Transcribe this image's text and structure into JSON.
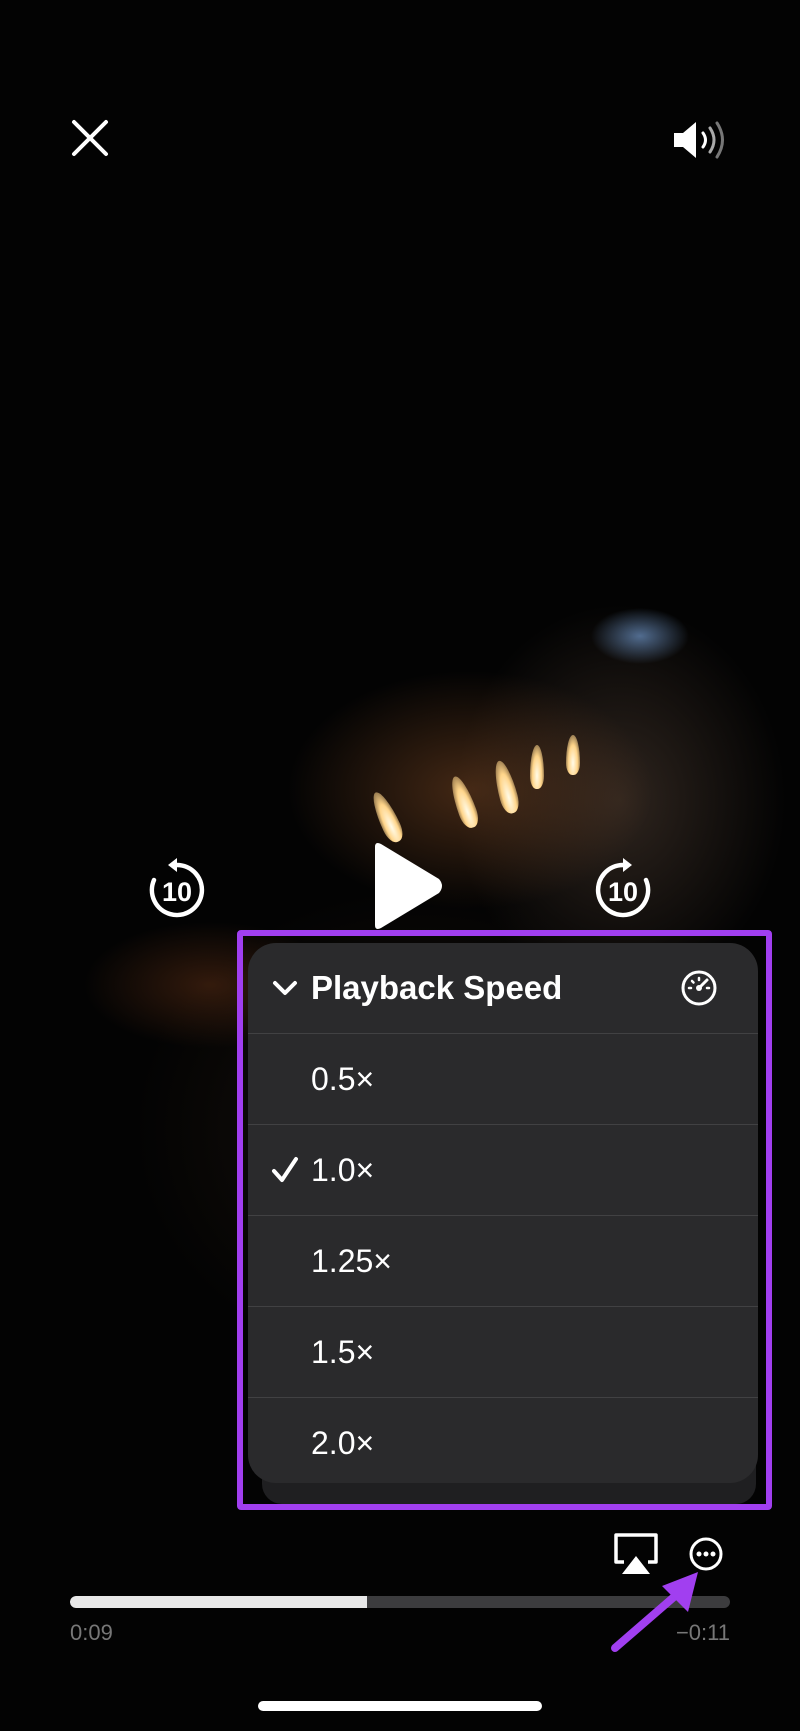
{
  "menu": {
    "title": "Playback Speed",
    "options": [
      "0.5×",
      "1.0×",
      "1.25×",
      "1.5×",
      "2.0×"
    ],
    "selected": "1.0×"
  },
  "player": {
    "skip_back": "10",
    "skip_forward": "10",
    "time_elapsed": "0:09",
    "time_remaining": "−0:11",
    "progress": 0.45
  },
  "icons": [
    "close-icon",
    "volume-icon",
    "skip-back-10-icon",
    "play-icon",
    "skip-forward-10-icon",
    "chevron-down-icon",
    "speedometer-icon",
    "checkmark-icon",
    "airplay-icon",
    "more-icon"
  ],
  "colors": {
    "highlight": "#a13ff0",
    "menu_bg": "#2a2a2c"
  }
}
